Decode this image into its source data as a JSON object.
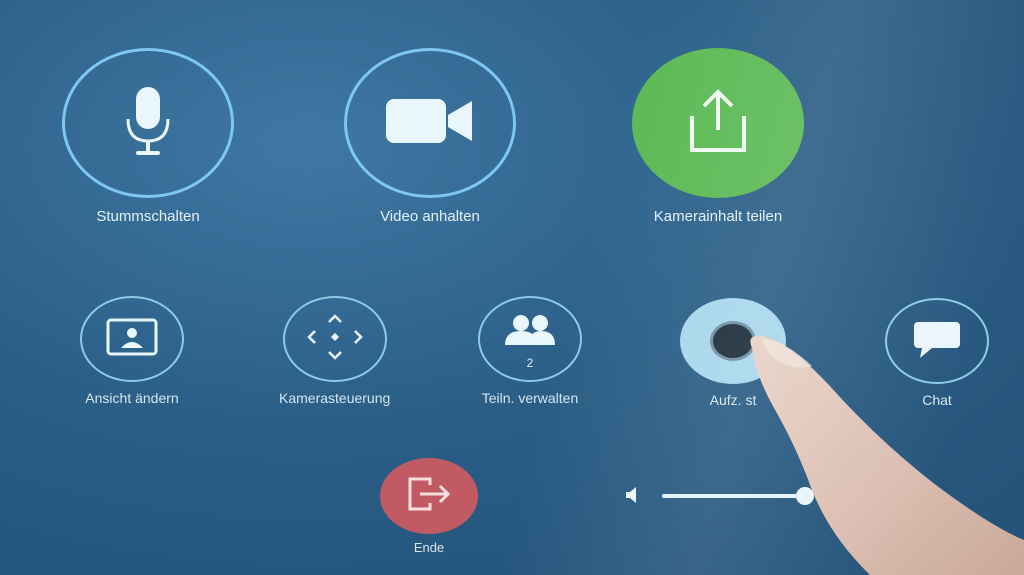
{
  "top_row": [
    {
      "label": "Stummschalten",
      "icon": "microphone-icon"
    },
    {
      "label": "Video anhalten",
      "icon": "video-camera-icon"
    },
    {
      "label": "Kamerainhalt teilen",
      "icon": "share-upload-icon"
    }
  ],
  "bottom_row": [
    {
      "label": "Ansicht ändern",
      "icon": "layout-view-icon"
    },
    {
      "label": "Kamerasteuerung",
      "icon": "camera-control-arrows-icon"
    },
    {
      "label": "Teiln. verwalten",
      "icon": "participants-icon",
      "count": "2"
    },
    {
      "label": "Aufz. st",
      "icon": "record-icon"
    },
    {
      "label": "Chat",
      "icon": "chat-bubble-icon"
    }
  ],
  "end_button": {
    "label": "Ende",
    "icon": "exit-icon"
  },
  "volume": {
    "level": 0.95,
    "icon": "speaker-icon"
  },
  "colors": {
    "background": "#2b5f88",
    "ring": "#7ec8f0",
    "share_green": "#5cba55",
    "end_red": "#c25a63",
    "record_active": "#a8d6ec"
  }
}
